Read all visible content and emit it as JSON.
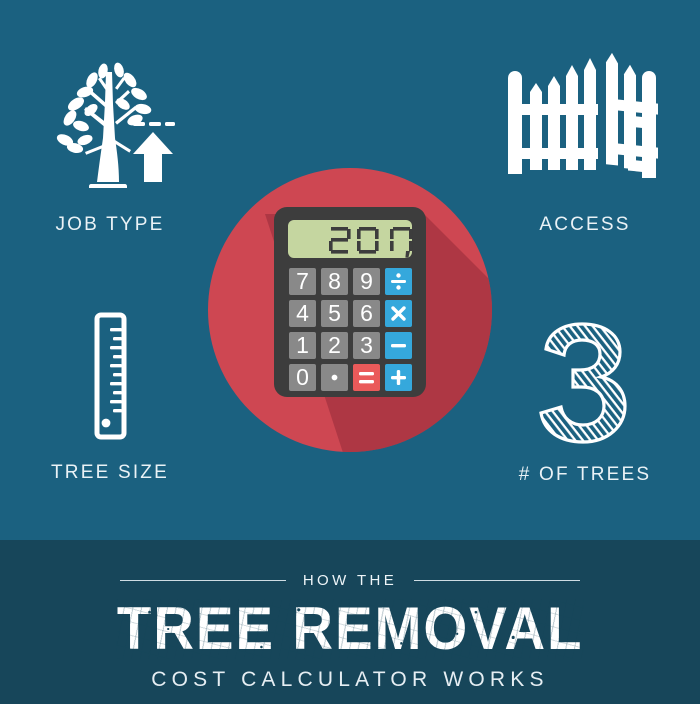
{
  "theme": {
    "bg_top": "#1b6180",
    "bg_bottom": "#17465a",
    "badge_red": "#ce4752",
    "badge_red_shadow": "#9b2d3c",
    "calculator_body": "#3d3d3d",
    "display_green": "#c5d6a0",
    "key_gray": "#898989",
    "key_blue": "#35a8dc",
    "key_equals_red": "#ea5a5a",
    "text_white": "#ffffff"
  },
  "tiles": [
    {
      "id": "job-type",
      "icon": "tree-with-up-arrow-icon",
      "label": "JOB TYPE"
    },
    {
      "id": "access",
      "icon": "open-picket-gate-icon",
      "label": "ACCESS"
    },
    {
      "id": "tree-size",
      "icon": "vertical-ruler-icon",
      "label": "TREE SIZE"
    },
    {
      "id": "num-trees",
      "icon": "hatched-numeral-three-icon",
      "label": "# OF TREES"
    }
  ],
  "calculator": {
    "display_value": "2017",
    "display_suffix": ",",
    "keys": [
      {
        "label": "7",
        "type": "digit"
      },
      {
        "label": "8",
        "type": "digit"
      },
      {
        "label": "9",
        "type": "digit"
      },
      {
        "label": "÷",
        "type": "operator"
      },
      {
        "label": "4",
        "type": "digit"
      },
      {
        "label": "5",
        "type": "digit"
      },
      {
        "label": "6",
        "type": "digit"
      },
      {
        "label": "×",
        "type": "operator"
      },
      {
        "label": "1",
        "type": "digit"
      },
      {
        "label": "2",
        "type": "digit"
      },
      {
        "label": "3",
        "type": "digit"
      },
      {
        "label": "−",
        "type": "operator"
      },
      {
        "label": "0",
        "type": "digit"
      },
      {
        "label": "·",
        "type": "digit"
      },
      {
        "label": "=",
        "type": "equals"
      },
      {
        "label": "+",
        "type": "operator"
      }
    ]
  },
  "title_block": {
    "eyebrow": "HOW THE",
    "headline": "TREE REMOVAL",
    "subhead": "COST CALCULATOR WORKS"
  }
}
